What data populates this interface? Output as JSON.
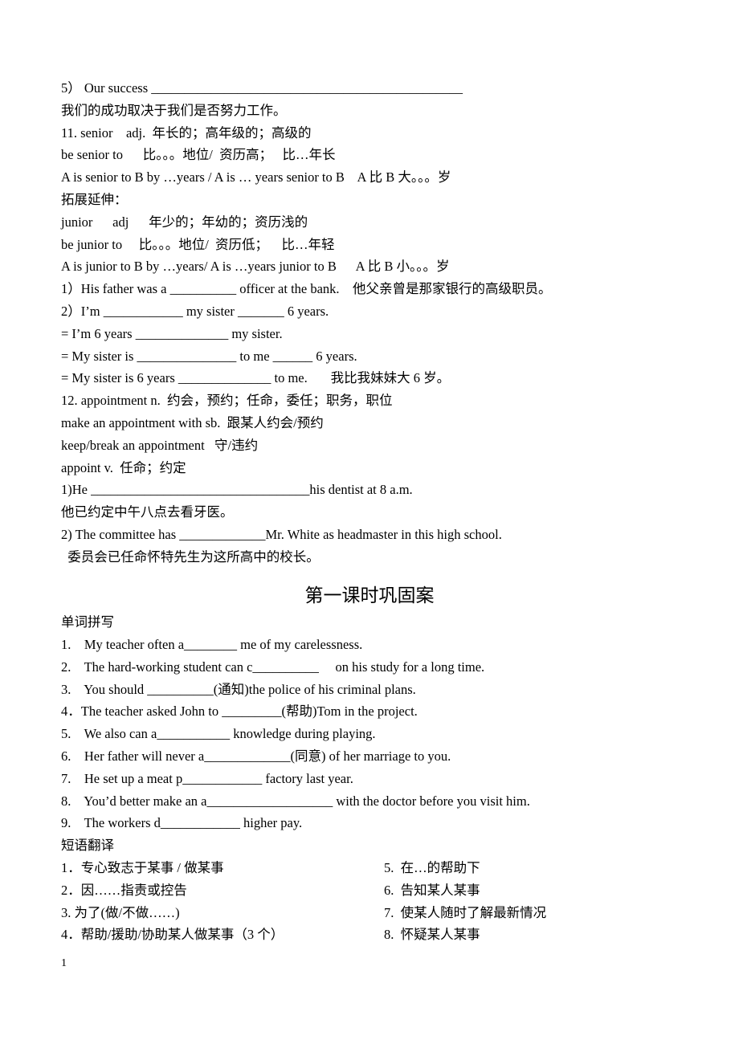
{
  "notes": [
    "5） Our success _______________________________________________",
    "我们的成功取决于我们是否努力工作。",
    "11. senior    adj.  年长的；高年级的；高级的",
    "be senior to      比。。。地位/  资历高；   比…年长",
    "A is senior to B by …years / A is … years senior to B    A 比 B 大。。。岁",
    "拓展延伸：",
    "junior      adj      年少的；年幼的；资历浅的",
    "be junior to     比。。。地位/  资历低；    比…年轻",
    "A is junior to B by …years/ A is …years junior to B      A 比 B 小。。。岁",
    "1）His father was a __________ officer at the bank.    他父亲曾是那家银行的高级职员。",
    "2）I’m ____________ my sister _______ 6 years.",
    "= I’m 6 years ______________ my sister.",
    "= My sister is _______________ to me ______ 6 years.",
    "= My sister is 6 years ______________ to me.       我比我妹妹大 6 岁。",
    "12. appointment n.  约会，预约；任命，委任；职务，职位",
    "make an appointment with sb.  跟某人约会/预约",
    "keep/break an appointment   守/违约",
    "appoint v.  任命；约定",
    "1)He _________________________________his dentist at 8 a.m.",
    "他已约定中午八点去看牙医。",
    "2) The committee has _____________Mr. White as headmaster in this high school.",
    "  委员会已任命怀特先生为这所高中的校长。"
  ],
  "section_title": "第一课时巩固案",
  "spelling": {
    "heading": "单词拼写",
    "items": [
      "1.    My teacher often a________ me of my carelessness.",
      "2.    The hard-working student can c__________     on his study for a long time.",
      "3.    You should __________(通知)the police of his criminal plans.",
      "4．The teacher asked John to _________(帮助)Tom in the project.",
      "5.    We also can a___________ knowledge during playing.",
      "6.    Her father will never a_____________(同意) of her marriage to you.",
      "7.    He set up a meat p____________ factory last year.",
      "8.    You’d better make an a___________________ with the doctor before you visit him.",
      "9.    The workers d____________ higher pay."
    ]
  },
  "phrases": {
    "heading": "短语翻译",
    "left": [
      "1．专心致志于某事 / 做某事",
      "2．因……指责或控告",
      "3. 为了(做/不做……)",
      "4．帮助/援助/协助某人做某事（3 个）"
    ],
    "right": [
      "5.  在…的帮助下",
      "6.  告知某人某事",
      "7.  使某人随时了解最新情况",
      "8.  怀疑某人某事"
    ]
  },
  "page_number": "1"
}
